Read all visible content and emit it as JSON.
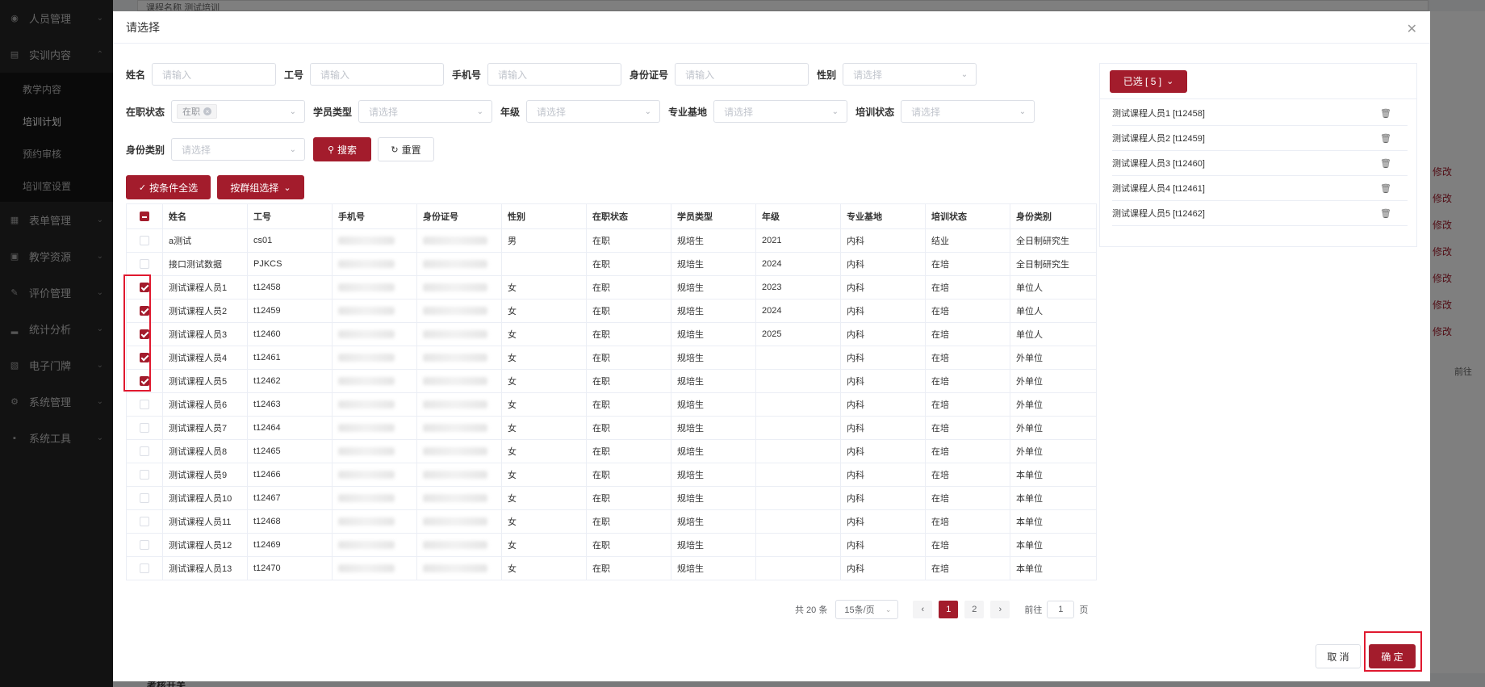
{
  "sidebar": {
    "items": [
      {
        "label": "人员管理",
        "icon": "user-icon"
      },
      {
        "label": "实训内容",
        "icon": "document-icon"
      },
      {
        "label": "表单管理",
        "icon": "form-icon"
      },
      {
        "label": "教学资源",
        "icon": "book-icon"
      },
      {
        "label": "评价管理",
        "icon": "edit-icon"
      },
      {
        "label": "统计分析",
        "icon": "bar-chart-icon"
      },
      {
        "label": "电子门牌",
        "icon": "monitor-icon"
      },
      {
        "label": "系统管理",
        "icon": "gear-icon"
      },
      {
        "label": "系统工具",
        "icon": "toolbox-icon"
      }
    ],
    "subitems": [
      "教学内容",
      "培训计划",
      "预约审核",
      "培训室设置"
    ]
  },
  "background": {
    "top_label": "课程名称",
    "top_value": "测试培训",
    "row_link": "修改",
    "goto_label": "前往",
    "footer_label": "考核开关"
  },
  "dialog": {
    "title": "请选择",
    "close_icon": "close-icon",
    "filters": {
      "name_label": "姓名",
      "name_placeholder": "请输入",
      "jobno_label": "工号",
      "jobno_placeholder": "请输入",
      "phone_label": "手机号",
      "phone_placeholder": "请输入",
      "idcard_label": "身份证号",
      "idcard_placeholder": "请输入",
      "gender_label": "性别",
      "gender_placeholder": "请选择",
      "employment_label": "在职状态",
      "employment_tag": "在职",
      "trainee_type_label": "学员类型",
      "trainee_type_placeholder": "请选择",
      "grade_label": "年级",
      "grade_placeholder": "请选择",
      "base_label": "专业基地",
      "base_placeholder": "请选择",
      "train_status_label": "培训状态",
      "train_status_placeholder": "请选择",
      "identity_label": "身份类别",
      "identity_placeholder": "请选择"
    },
    "search_label": "搜索",
    "reset_label": "重置",
    "select_all_label": "按条件全选",
    "group_select_label": "按群组选择",
    "table": {
      "headers": [
        "姓名",
        "工号",
        "手机号",
        "身份证号",
        "性别",
        "在职状态",
        "学员类型",
        "年级",
        "专业基地",
        "培训状态",
        "身份类别"
      ],
      "rows": [
        {
          "checked": false,
          "name": "a测试",
          "no": "cs01",
          "gender": "男",
          "emp": "在职",
          "type": "规培生",
          "grade": "2021",
          "base": "内科",
          "status": "结业",
          "identity": "全日制研究生"
        },
        {
          "checked": false,
          "name": "接口测试数据",
          "no": "PJKCS",
          "gender": "",
          "emp": "在职",
          "type": "规培生",
          "grade": "2024",
          "base": "内科",
          "status": "在培",
          "identity": "全日制研究生"
        },
        {
          "checked": true,
          "name": "测试课程人员1",
          "no": "t12458",
          "gender": "女",
          "emp": "在职",
          "type": "规培生",
          "grade": "2023",
          "base": "内科",
          "status": "在培",
          "identity": "单位人"
        },
        {
          "checked": true,
          "name": "测试课程人员2",
          "no": "t12459",
          "gender": "女",
          "emp": "在职",
          "type": "规培生",
          "grade": "2024",
          "base": "内科",
          "status": "在培",
          "identity": "单位人"
        },
        {
          "checked": true,
          "name": "测试课程人员3",
          "no": "t12460",
          "gender": "女",
          "emp": "在职",
          "type": "规培生",
          "grade": "2025",
          "base": "内科",
          "status": "在培",
          "identity": "单位人"
        },
        {
          "checked": true,
          "name": "测试课程人员4",
          "no": "t12461",
          "gender": "女",
          "emp": "在职",
          "type": "规培生",
          "grade": "",
          "base": "内科",
          "status": "在培",
          "identity": "外单位"
        },
        {
          "checked": true,
          "name": "测试课程人员5",
          "no": "t12462",
          "gender": "女",
          "emp": "在职",
          "type": "规培生",
          "grade": "",
          "base": "内科",
          "status": "在培",
          "identity": "外单位"
        },
        {
          "checked": false,
          "name": "测试课程人员6",
          "no": "t12463",
          "gender": "女",
          "emp": "在职",
          "type": "规培生",
          "grade": "",
          "base": "内科",
          "status": "在培",
          "identity": "外单位"
        },
        {
          "checked": false,
          "name": "测试课程人员7",
          "no": "t12464",
          "gender": "女",
          "emp": "在职",
          "type": "规培生",
          "grade": "",
          "base": "内科",
          "status": "在培",
          "identity": "外单位"
        },
        {
          "checked": false,
          "name": "测试课程人员8",
          "no": "t12465",
          "gender": "女",
          "emp": "在职",
          "type": "规培生",
          "grade": "",
          "base": "内科",
          "status": "在培",
          "identity": "外单位"
        },
        {
          "checked": false,
          "name": "测试课程人员9",
          "no": "t12466",
          "gender": "女",
          "emp": "在职",
          "type": "规培生",
          "grade": "",
          "base": "内科",
          "status": "在培",
          "identity": "本单位"
        },
        {
          "checked": false,
          "name": "测试课程人员10",
          "no": "t12467",
          "gender": "女",
          "emp": "在职",
          "type": "规培生",
          "grade": "",
          "base": "内科",
          "status": "在培",
          "identity": "本单位"
        },
        {
          "checked": false,
          "name": "测试课程人员11",
          "no": "t12468",
          "gender": "女",
          "emp": "在职",
          "type": "规培生",
          "grade": "",
          "base": "内科",
          "status": "在培",
          "identity": "本单位"
        },
        {
          "checked": false,
          "name": "测试课程人员12",
          "no": "t12469",
          "gender": "女",
          "emp": "在职",
          "type": "规培生",
          "grade": "",
          "base": "内科",
          "status": "在培",
          "identity": "本单位"
        },
        {
          "checked": false,
          "name": "测试课程人员13",
          "no": "t12470",
          "gender": "女",
          "emp": "在职",
          "type": "规培生",
          "grade": "",
          "base": "内科",
          "status": "在培",
          "identity": "本单位"
        }
      ]
    },
    "pagination": {
      "total_label": "共 20 条",
      "page_size": "15条/页",
      "pages": [
        "1",
        "2"
      ],
      "current_page": "1",
      "goto_label": "前往",
      "goto_value": "1",
      "page_unit": "页"
    },
    "selected_panel": {
      "header": "已选 [ 5 ]",
      "items": [
        "测试课程人员1 [t12458]",
        "测试课程人员2 [t12459]",
        "测试课程人员3 [t12460]",
        "测试课程人员4 [t12461]",
        "测试课程人员5 [t12462]"
      ]
    },
    "cancel_label": "取 消",
    "confirm_label": "确 定"
  },
  "colors": {
    "primary": "#a31c2c",
    "highlight": "#e0192f",
    "sidebar": "#242424"
  }
}
